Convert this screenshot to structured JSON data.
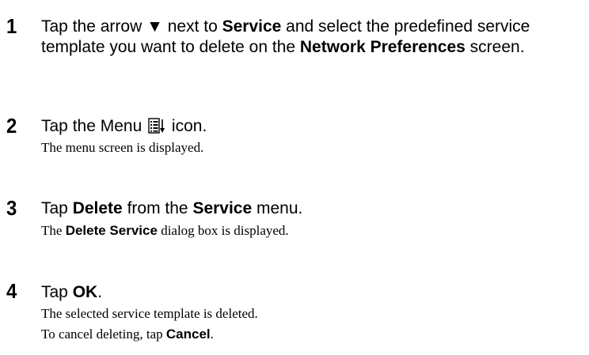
{
  "steps": [
    {
      "number": "1",
      "text_a": "Tap the arrow ",
      "arrow_glyph": "▼",
      "text_b": " next to ",
      "bold_service": "Service",
      "text_c": " and select the predefined service template you want to delete on the ",
      "bold_network_preferences": "Network Preferences",
      "text_d": " screen."
    },
    {
      "number": "2",
      "text_a": "Tap the Menu ",
      "icon": "menu-icon",
      "text_b": " icon.",
      "result": "The menu screen is displayed."
    },
    {
      "number": "3",
      "text_a": "Tap ",
      "bold_delete": "Delete",
      "text_b": " from the ",
      "bold_service": "Service",
      "text_c": " menu.",
      "result_a": "The ",
      "result_bold": "Delete Service",
      "result_b": " dialog box is displayed."
    },
    {
      "number": "4",
      "text_a": "Tap ",
      "bold_ok": "OK",
      "text_b": ".",
      "result_1": "The selected service template is deleted.",
      "result_2_a": "To cancel deleting, tap ",
      "result_2_bold": "Cancel",
      "result_2_b": "."
    }
  ]
}
